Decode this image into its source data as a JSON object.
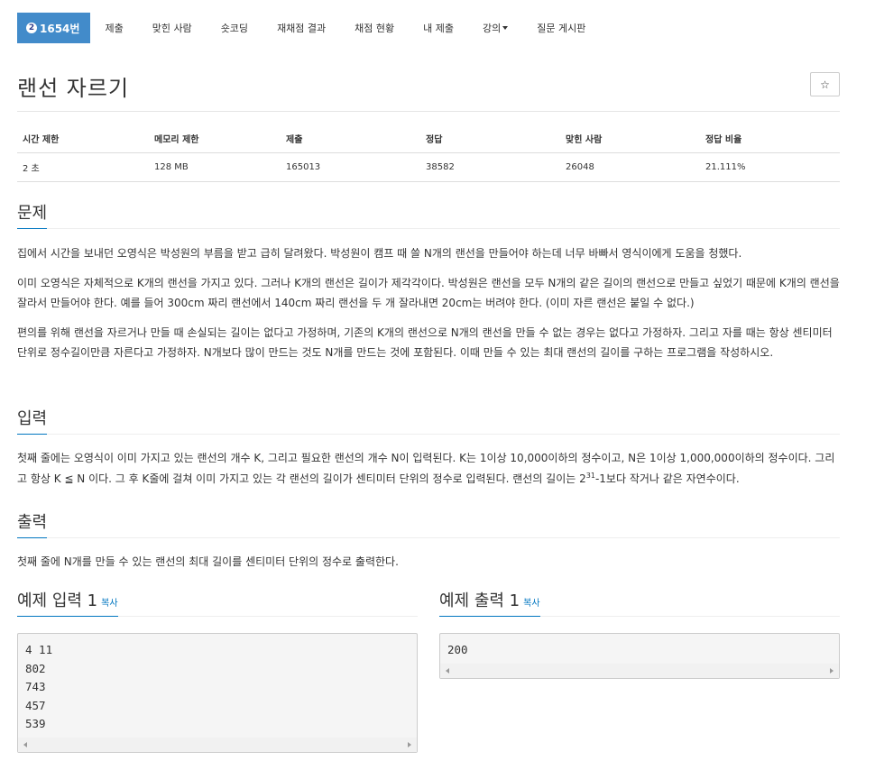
{
  "nav": {
    "brand_icon": "2",
    "brand": "1654번",
    "items": [
      "제출",
      "맞힌 사람",
      "숏코딩",
      "재채점 결과",
      "채점 현황",
      "내 제출",
      "강의",
      "질문 게시판"
    ]
  },
  "problem": {
    "title": "랜선 자르기",
    "star": "☆"
  },
  "info_table": {
    "headers": [
      "시간 제한",
      "메모리 제한",
      "제출",
      "정답",
      "맞힌 사람",
      "정답 비율"
    ],
    "values": [
      "2 초",
      "128 MB",
      "165013",
      "38582",
      "26048",
      "21.111%"
    ]
  },
  "sections": {
    "description": {
      "heading": "문제",
      "paragraphs": [
        "집에서 시간을 보내던 오영식은 박성원의 부름을 받고 급히 달려왔다. 박성원이 캠프 때 쓸 N개의 랜선을 만들어야 하는데 너무 바빠서 영식이에게 도움을 청했다.",
        "이미 오영식은 자체적으로 K개의 랜선을 가지고 있다. 그러나 K개의 랜선은 길이가 제각각이다. 박성원은 랜선을 모두 N개의 같은 길이의 랜선으로 만들고 싶었기 때문에 K개의 랜선을 잘라서 만들어야 한다. 예를 들어 300cm 짜리 랜선에서 140cm 짜리 랜선을 두 개 잘라내면 20cm는 버려야 한다. (이미 자른 랜선은 붙일 수 없다.)",
        "편의를 위해 랜선을 자르거나 만들 때 손실되는 길이는 없다고 가정하며, 기존의 K개의 랜선으로 N개의 랜선을 만들 수 없는 경우는 없다고 가정하자. 그리고 자를 때는 항상 센티미터 단위로 정수길이만큼 자른다고 가정하자. N개보다 많이 만드는 것도 N개를 만드는 것에 포함된다. 이때 만들 수 있는 최대 랜선의 길이를 구하는 프로그램을 작성하시오."
      ]
    },
    "input": {
      "heading": "입력",
      "text_before": "첫째 줄에는 오영식이 이미 가지고 있는 랜선의 개수 K, 그리고 필요한 랜선의 개수 N이 입력된다. K는 1이상 10,000이하의 정수이고, N은 1이상 1,000,000이하의 정수이다. 그리고 항상 K ≦ N 이다. 그 후 K줄에 걸쳐 이미 가지고 있는 각 랜선의 길이가 센티미터 단위의 정수로 입력된다. 랜선의 길이는 2",
      "sup": "31",
      "text_after": "-1보다 작거나 같은 자연수이다."
    },
    "output": {
      "heading": "출력",
      "text": "첫째 줄에 N개를 만들 수 있는 랜선의 최대 길이를 센티미터 단위의 정수로 출력한다."
    }
  },
  "samples": {
    "input": {
      "heading": "예제 입력 1",
      "copy": "복사",
      "content": "4 11\n802\n743\n457\n539"
    },
    "output": {
      "heading": "예제 출력 1",
      "copy": "복사",
      "content": "200"
    }
  },
  "colors": {
    "brand": "#428bca",
    "link": "#0076c0"
  }
}
